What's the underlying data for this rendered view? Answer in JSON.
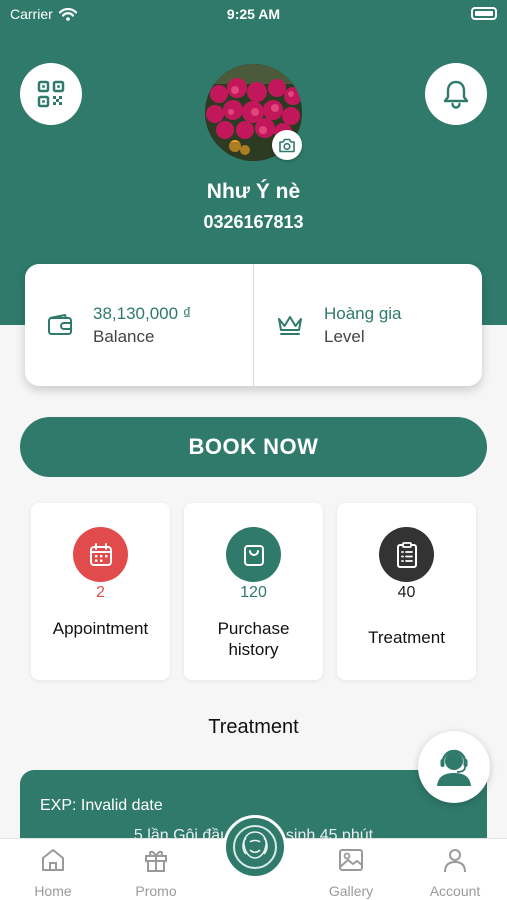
{
  "status_bar": {
    "carrier": "Carrier",
    "time": "9:25 AM"
  },
  "profile": {
    "name": "Như Ý nè",
    "phone": "0326167813"
  },
  "balance": {
    "value": "38,130,000 ₫",
    "label": "Balance"
  },
  "level": {
    "value": "Hoàng gia",
    "label": "Level"
  },
  "book_button": {
    "label": "BOOK NOW"
  },
  "stats": [
    {
      "count": "2",
      "label": "Appointment",
      "icon": "calendar-icon",
      "color": "#e24b4b",
      "count_color": "#e24b4b"
    },
    {
      "count": "120",
      "label": "Purchase history",
      "icon": "shopping-bag-icon",
      "color": "#2f7a6b",
      "count_color": "#2f7a6b"
    },
    {
      "count": "40",
      "label": "Treatment",
      "icon": "clipboard-icon",
      "color": "#333333",
      "count_color": "#222222"
    }
  ],
  "section": {
    "title": "Treatment"
  },
  "treatment_card": {
    "exp": "EXP: Invalid date",
    "name": "5 lần Gội đầu dưỡng sinh 45 phút"
  },
  "tabs": [
    {
      "label": "Home",
      "icon": "home-icon"
    },
    {
      "label": "Promo",
      "icon": "gift-icon"
    },
    {
      "label": "",
      "icon": "brand-logo-icon"
    },
    {
      "label": "Gallery",
      "icon": "image-icon"
    },
    {
      "label": "Account",
      "icon": "user-icon"
    }
  ],
  "colors": {
    "primary": "#2f7a6b",
    "background": "#f6f6f6",
    "accent_red": "#e24b4b"
  }
}
